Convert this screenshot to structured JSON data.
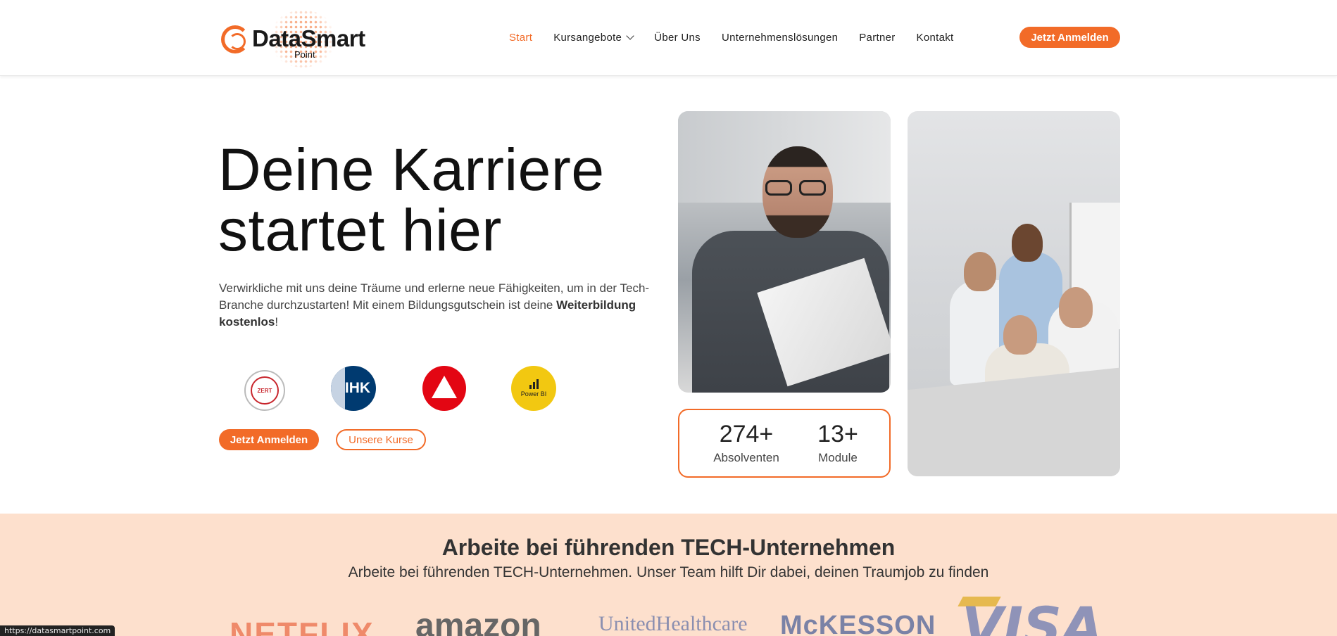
{
  "brand": {
    "name": "DataSmart",
    "sub": "Point"
  },
  "nav": {
    "items": [
      {
        "label": "Start",
        "active": true
      },
      {
        "label": "Kursangebote",
        "dropdown": true
      },
      {
        "label": "Über Uns"
      },
      {
        "label": "Unternehmenslösungen"
      },
      {
        "label": "Partner"
      },
      {
        "label": "Kontakt"
      }
    ],
    "cta": "Jetzt Anmelden"
  },
  "hero": {
    "title_line1": "Deine Karriere",
    "title_line2": "startet hier",
    "text_part1": "Verwirkliche mit uns deine Träume und erlerne neue Fähigkeiten, um in der Tech-Branche durchzustarten! Mit einem Bildungsgutschein ist deine ",
    "text_bold": "Weiterbildung kostenlos",
    "text_end": "!",
    "badges": {
      "zert": "ZERT",
      "ihk": "IHK",
      "pbi": "Power BI"
    },
    "primary_button": "Jetzt Anmelden",
    "secondary_button": "Unsere Kurse"
  },
  "stats": [
    {
      "value": "274+",
      "label": "Absolventen"
    },
    {
      "value": "13+",
      "label": "Module"
    }
  ],
  "partners": {
    "title": "Arbeite bei führenden TECH-Unternehmen",
    "subtitle": "Arbeite bei führenden TECH-Unternehmen. Unser Team hilft Dir dabei, deinen Traumjob zu finden",
    "logos": [
      "NETFLIX",
      "amazon",
      "UnitedHealthcare",
      "McKESSON",
      "VISA"
    ]
  },
  "status_url": "https://datasmartpoint.com",
  "colors": {
    "accent": "#f26b28",
    "band": "#fde0cd"
  }
}
